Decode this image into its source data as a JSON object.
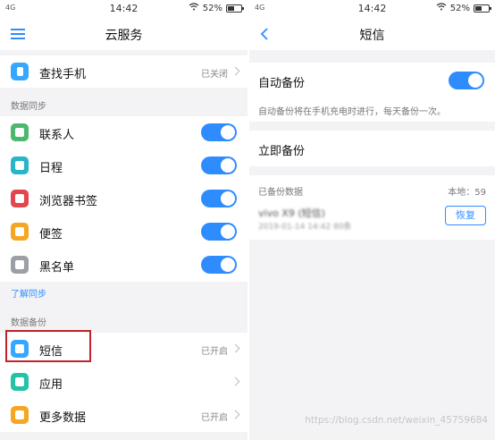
{
  "left_screen": {
    "status": {
      "network": "4G",
      "time": "14:42",
      "battery": "52%",
      "battery_level": 0.52
    },
    "title": "云服务",
    "find_phone": {
      "label": "查找手机",
      "value": "已关闭"
    },
    "sync_section": "数据同步",
    "sync_items": [
      {
        "label": "联系人",
        "enabled": true,
        "icon": "contacts-icon",
        "color": "#4cb86d"
      },
      {
        "label": "日程",
        "enabled": true,
        "icon": "calendar-icon",
        "color": "#27b5c9"
      },
      {
        "label": "浏览器书签",
        "enabled": true,
        "icon": "bookmark-icon",
        "color": "#e2474f"
      },
      {
        "label": "便签",
        "enabled": true,
        "icon": "note-icon",
        "color": "#f5a623"
      },
      {
        "label": "黑名单",
        "enabled": true,
        "icon": "blacklist-icon",
        "color": "#9aa0a6"
      }
    ],
    "learn_sync": "了解同步",
    "backup_section": "数据备份",
    "backup_items": [
      {
        "label": "短信",
        "value": "已开启",
        "icon": "sms-icon",
        "color": "#35a7ff"
      },
      {
        "label": "应用",
        "value": "",
        "icon": "apps-icon",
        "color": "#23c3a8"
      },
      {
        "label": "更多数据",
        "value": "已开启",
        "icon": "more-data-icon",
        "color": "#f5a623"
      }
    ]
  },
  "right_screen": {
    "status": {
      "network": "4G",
      "time": "14:42",
      "battery": "52%",
      "battery_level": 0.52
    },
    "title": "短信",
    "auto_backup": {
      "label": "自动备份",
      "enabled": true
    },
    "auto_backup_desc": "自动备份将在手机充电时进行，每天备份一次。",
    "backup_now": "立即备份",
    "backed_up_label": "已备份数据",
    "local_count": "本地：59",
    "backup_entry": {
      "name": "vivo X9 (短信)",
      "date": "2019-01-14 14:42 80条"
    },
    "restore": "恢复"
  },
  "watermark": "https://blog.csdn.net/weixin_45759684",
  "colors": {
    "accent": "#2f8cff",
    "highlight": "#c0232c"
  }
}
